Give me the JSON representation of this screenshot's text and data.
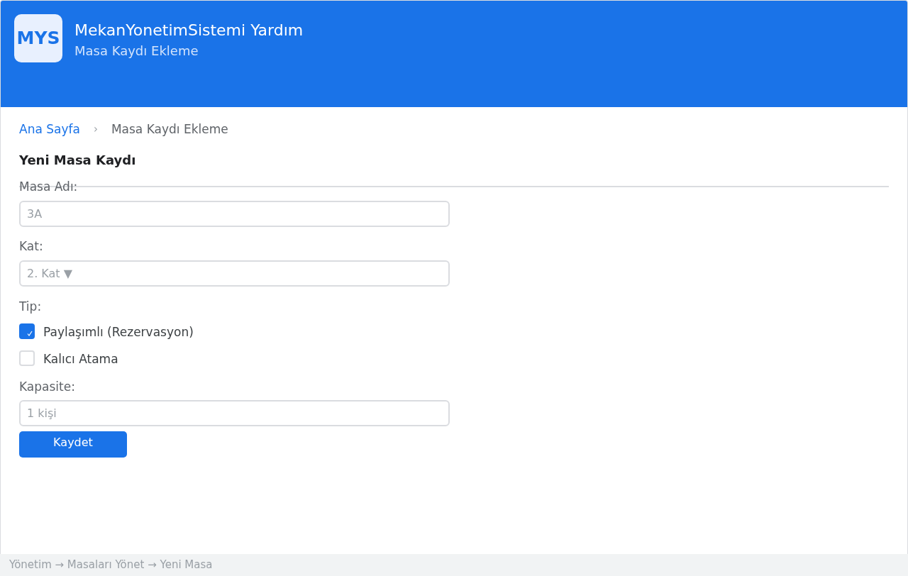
{
  "header": {
    "logo": "MYS",
    "title": "MekanYonetimSistemi Yardım",
    "subtitle": "Masa Kaydı Ekleme"
  },
  "breadcrumb": {
    "items": [
      {
        "label": "Ana Sayfa",
        "kind": "link"
      },
      {
        "label": "Masa Kaydı Ekleme",
        "kind": "current"
      }
    ],
    "separator": "›"
  },
  "form": {
    "title": "Yeni Masa Kaydı",
    "fields": [
      {
        "kind": "text",
        "label": "Masa Adı:",
        "placeholder": "3A"
      },
      {
        "kind": "select",
        "label": "Kat:",
        "placeholder": "2. Kat",
        "caret": "▼"
      },
      {
        "kind": "checkboxes",
        "label": "Tip:",
        "options": [
          {
            "label": "Paylaşımlı (Rezervasyon)",
            "checked": true
          },
          {
            "label": "Kalıcı Atama",
            "checked": false
          }
        ]
      },
      {
        "kind": "text",
        "label": "Kapasite:",
        "placeholder": "1 kişi"
      }
    ],
    "submit": "Kaydet"
  },
  "status_bar": {
    "path": "Yönetim → Masaları Yönet → Yeni Masa"
  }
}
